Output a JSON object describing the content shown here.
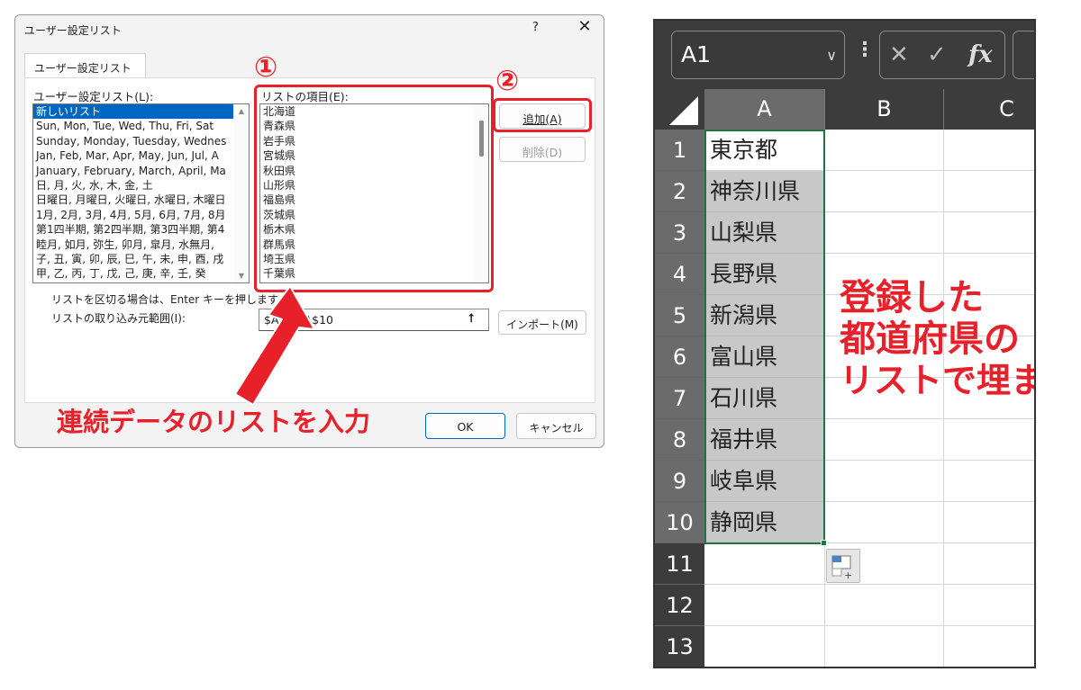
{
  "dialog": {
    "title": "ユーザー設定リスト",
    "help": "?",
    "close": "✕",
    "tab": "ユーザー設定リスト",
    "custom_lists_label": "ユーザー設定リスト(L):",
    "custom_lists": [
      "新しいリスト",
      "Sun, Mon, Tue, Wed, Thu, Fri, Sat",
      "Sunday, Monday, Tuesday, Wednes",
      "Jan, Feb, Mar, Apr, May, Jun, Jul, A",
      "January, February, March, April, Ma",
      "日, 月, 火, 水, 木, 金, 土",
      "日曜日, 月曜日, 火曜日, 水曜日, 木曜日",
      "1月, 2月, 3月, 4月, 5月, 6月, 7月, 8月",
      "第1四半期, 第2四半期, 第3四半期, 第4",
      "睦月, 如月, 弥生, 卯月, 皐月, 水無月,",
      "子, 丑, 寅, 卯, 辰, 巳, 午, 未, 申, 酉, 戌",
      "甲, 乙, 丙, 丁, 戊, 己, 庚, 辛, 壬, 癸"
    ],
    "entries_label": "リストの項目(E):",
    "entries": [
      "北海道",
      "青森県",
      "岩手県",
      "宮城県",
      "秋田県",
      "山形県",
      "福島県",
      "茨城県",
      "栃木県",
      "群馬県",
      "埼玉県",
      "千葉県"
    ],
    "add_button": "追加(A)",
    "delete_button": "削除(D)",
    "separator_note": "リストを区切る場合は、Enter キーを押します。",
    "import_label": "リストの取り込み元範囲(I):",
    "import_value": "$A$1:$A$10",
    "import_button": "インポート(M)",
    "ok_button": "OK",
    "cancel_button": "キャンセル"
  },
  "annotations": {
    "step1": "①",
    "step2": "②",
    "caption": "連続データのリストを入力",
    "callout_lines": [
      "登録した",
      "都道府県の",
      "リストで埋まる"
    ],
    "accent_color": "#e8202a"
  },
  "excel": {
    "name_box": "A1",
    "formula_icons": [
      "✕",
      "✓",
      "fx"
    ],
    "columns": [
      "A",
      "B",
      "C"
    ],
    "rows": [
      {
        "num": "1",
        "a": "東京都"
      },
      {
        "num": "2",
        "a": "神奈川県"
      },
      {
        "num": "3",
        "a": "山梨県"
      },
      {
        "num": "4",
        "a": "長野県"
      },
      {
        "num": "5",
        "a": "新潟県"
      },
      {
        "num": "6",
        "a": "富山県"
      },
      {
        "num": "7",
        "a": "石川県"
      },
      {
        "num": "8",
        "a": "福井県"
      },
      {
        "num": "9",
        "a": "岐阜県"
      },
      {
        "num": "10",
        "a": "静岡県"
      },
      {
        "num": "11",
        "a": ""
      },
      {
        "num": "12",
        "a": ""
      },
      {
        "num": "13",
        "a": ""
      }
    ]
  }
}
